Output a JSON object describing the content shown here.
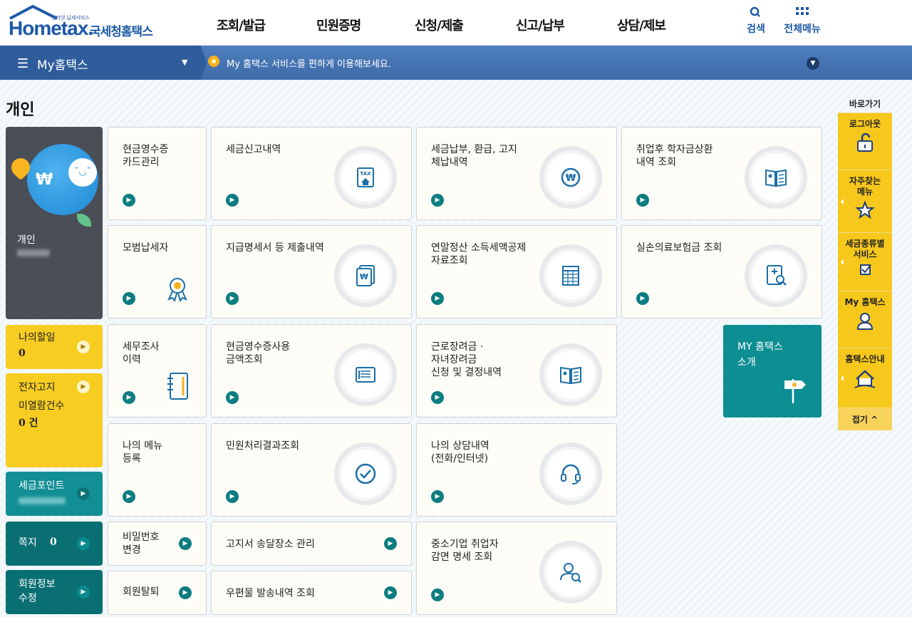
{
  "header": {
    "logo_small": "인터넷 납세서비스",
    "logo_text": "Hometax.",
    "logo_kr": "국세청홈택스",
    "nav": [
      "조회/발급",
      "민원증명",
      "신청/제출",
      "신고/납부",
      "상담/제보"
    ],
    "search_label": "검색",
    "menu_label": "전체메뉴"
  },
  "mybar": {
    "title": "My홈택스",
    "message": "My 홈택스 서비스를 편하게 이용해보세요."
  },
  "page": {
    "title": "개인",
    "profile_label": "개인"
  },
  "side": {
    "todo_label": "나의할일",
    "todo_count": "0",
    "enotice_line1": "전자고지",
    "enotice_line2": "미열람건수",
    "enotice_count": "0 건",
    "tax_point": "세금포인트",
    "note_label": "쪽지",
    "note_count": "0",
    "member_line1": "회원정보",
    "member_line2": "수정"
  },
  "cards": {
    "c1": "현금영수증\n카드관리",
    "c2": "세금신고내역",
    "c3": "세금납부, 환급, 고지\n체납내역",
    "c4": "취업후 학자금상환\n내역 조회",
    "c5": "모범납세자",
    "c6": "지급명세서 등 제출내역",
    "c7": "연말정산 소득세액공제\n자료조회",
    "c8": "실손의료보험금 조회",
    "c9": "세무조사\n이력",
    "c10": "현금영수증사용\n금액조회",
    "c11": "근로장려금 ·\n자녀장려금\n신청 및 결정내역",
    "c12": "나의 메뉴\n등록",
    "c13": "민원처리결과조회",
    "c14": "나의 상담내역\n(전화/인터넷)",
    "c15": "비밀번호\n변경",
    "c16": "고지서 송달장소 관리",
    "c17": "중소기업 취업자\n감면 명세 조회",
    "c18": "회원탈퇴",
    "c19": "우편물 발송내역 조회",
    "my": "MY 홈택스\n소개"
  },
  "quick": {
    "title": "바로가기",
    "items": [
      "로그아웃",
      "자주찾는\n메뉴",
      "세금종류별\n서비스",
      "My 홈택스",
      "홈택스안내"
    ],
    "fold": "접기 ^"
  },
  "colors": {
    "brand_blue": "#1e58a8",
    "yellow": "#f7cd22",
    "teal": "#128f95",
    "dark_teal": "#0a6f73"
  }
}
